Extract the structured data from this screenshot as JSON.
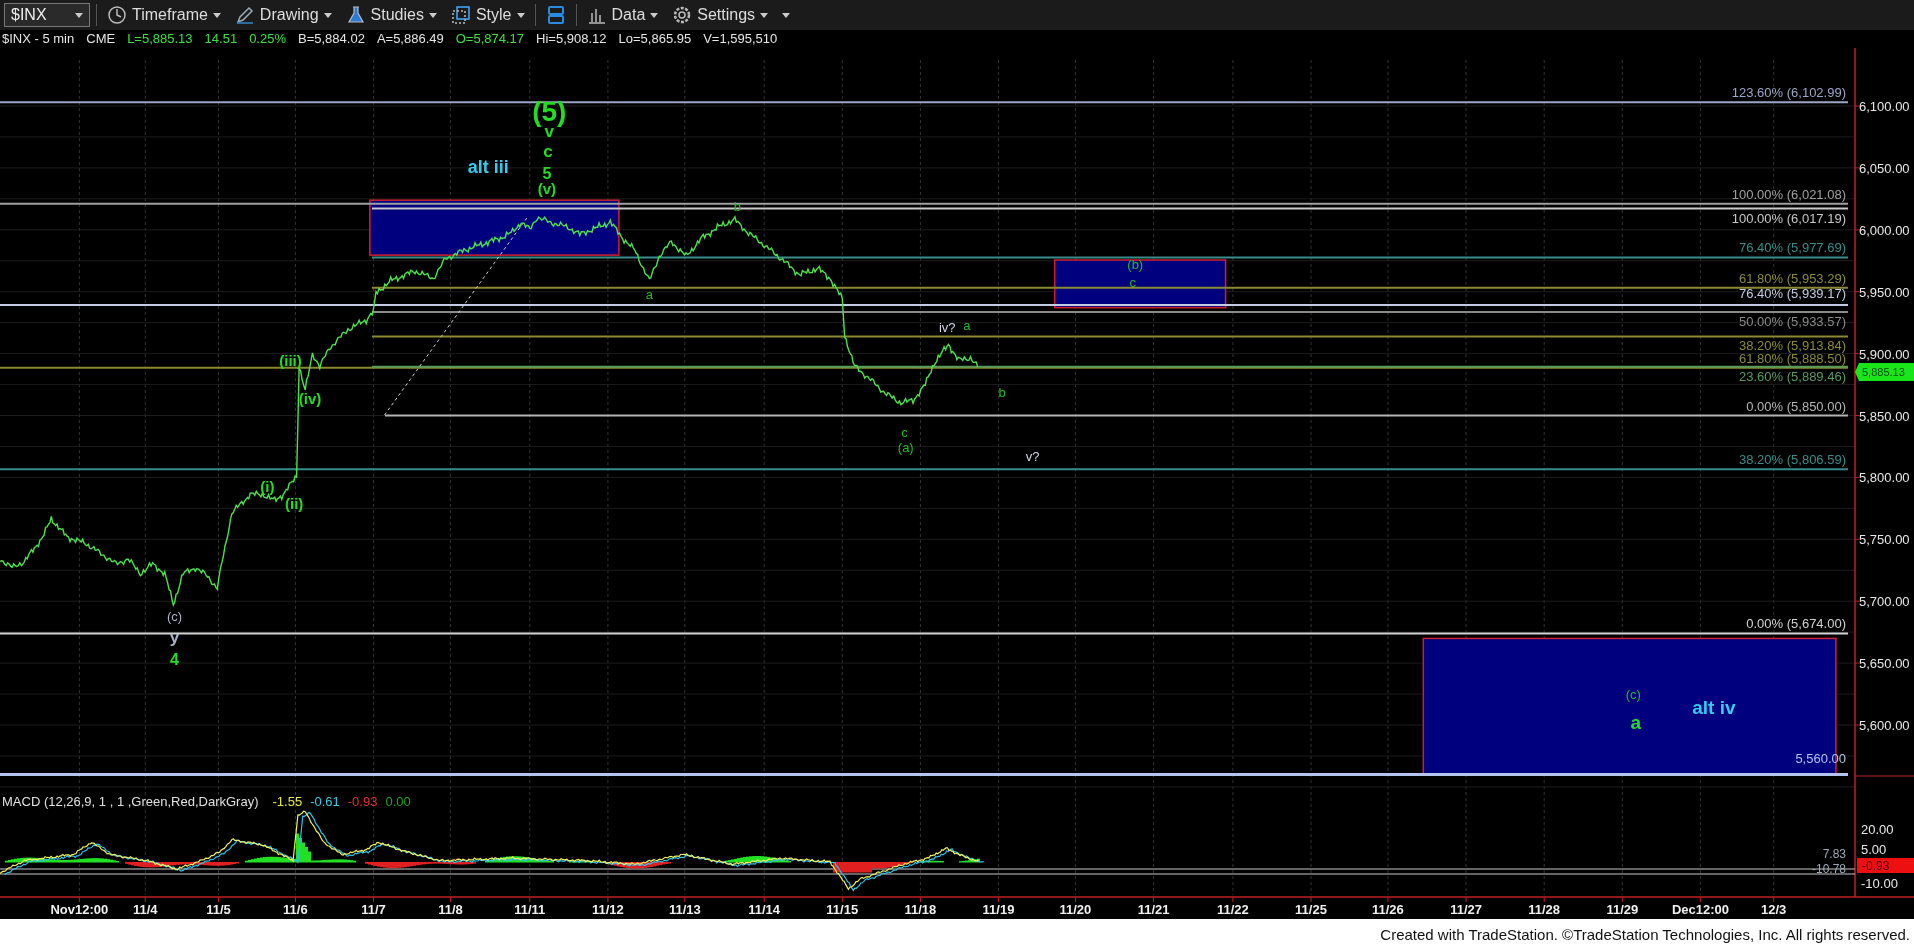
{
  "toolbar": {
    "symbol": "$INX",
    "buttons": [
      {
        "label": "Timeframe"
      },
      {
        "label": "Drawing"
      },
      {
        "label": "Studies"
      },
      {
        "label": "Style"
      },
      {
        "label": "Data"
      },
      {
        "label": "Settings"
      }
    ]
  },
  "quote_line": [
    {
      "text": "$INX - 5 min",
      "color": "#e6e6e6"
    },
    {
      "text": "CME",
      "color": "#e6e6e6"
    },
    {
      "text": "L=5,885.13",
      "color": "#3ee03e"
    },
    {
      "text": "14.51",
      "color": "#3ee03e"
    },
    {
      "text": "0.25%",
      "color": "#3ee03e"
    },
    {
      "text": "B=5,884.02",
      "color": "#e6e6e6"
    },
    {
      "text": "A=5,886.49",
      "color": "#e6e6e6"
    },
    {
      "text": "O=5,874.17",
      "color": "#3ee03e"
    },
    {
      "text": "Hi=5,908.12",
      "color": "#e6e6e6"
    },
    {
      "text": "Lo=5,865.95",
      "color": "#e6e6e6"
    },
    {
      "text": "V=1,595,510",
      "color": "#e6e6e6"
    }
  ],
  "price_axis": {
    "ticks": [
      "6,100.00",
      "6,050.00",
      "6,000.00",
      "5,950.00",
      "5,900.00",
      "5,850.00",
      "5,800.00",
      "5,750.00",
      "5,700.00",
      "5,650.00",
      "5,600.00"
    ],
    "last_price": "5,885.13"
  },
  "fib_levels": [
    {
      "label": "123.60% (6,102.99)",
      "color": "#9aa6c4"
    },
    {
      "label": "100.00% (6,021.08)",
      "color": "#a0a0a0"
    },
    {
      "label": "100.00% (6,017.19)",
      "color": "#c8c8c8"
    },
    {
      "label": "76.40% (5,977.69)",
      "color": "#3a8c8c"
    },
    {
      "label": "61.80% (5,953.29)",
      "color": "#8c8a34"
    },
    {
      "label": "76.40% (5,939.17)",
      "color": "#c4cce4"
    },
    {
      "label": "50.00% (5,933.57)",
      "color": "#8a8a8a"
    },
    {
      "label": "38.20% (5,913.84)",
      "color": "#8c8a34"
    },
    {
      "label": "61.80% (5,888.50)",
      "color": "#8a8a30"
    },
    {
      "label": "23.60% (5,889.46)",
      "color": "#5a9a5a"
    },
    {
      "label": "0.00% (5,850.00)",
      "color": "#b4b4b4"
    },
    {
      "label": "38.20% (5,806.59)",
      "color": "#3a8c8c"
    },
    {
      "label": "0.00% (5,674.00)",
      "color": "#d2d2d2"
    },
    {
      "label": "5,560.00",
      "color": "#b4c4ec"
    }
  ],
  "wave_labels": [
    {
      "text": "(5)",
      "color": "#22dd22"
    },
    {
      "text": "v",
      "color": "#22dd22"
    },
    {
      "text": "c",
      "color": "#22dd22"
    },
    {
      "text": "5",
      "color": "#22dd22"
    },
    {
      "text": "(v)",
      "color": "#22dd22"
    },
    {
      "text": "alt iii",
      "color": "#33ccee"
    },
    {
      "text": "b",
      "color": "#22bb22"
    },
    {
      "text": "a",
      "color": "#22bb22"
    },
    {
      "text": "(iii)",
      "color": "#22dd22"
    },
    {
      "text": "(iv)",
      "color": "#22dd22"
    },
    {
      "text": "(i)",
      "color": "#22dd22"
    },
    {
      "text": "(ii)",
      "color": "#22dd22"
    },
    {
      "text": "(c)",
      "color": "#aab4c8"
    },
    {
      "text": "y",
      "color": "#aab4c8"
    },
    {
      "text": "4",
      "color": "#22dd22"
    },
    {
      "text": "iv?",
      "color": "#d0d4e8"
    },
    {
      "text": "a",
      "color": "#22bb22"
    },
    {
      "text": "b",
      "color": "#22bb22"
    },
    {
      "text": "c",
      "color": "#22bb22"
    },
    {
      "text": "(a)",
      "color": "#22bb22"
    },
    {
      "text": "v?",
      "color": "#d0d4e8"
    },
    {
      "text": "(b)",
      "color": "#22bb22"
    },
    {
      "text": "c",
      "color": "#22bb22"
    },
    {
      "text": "(c)",
      "color": "#22bb22"
    },
    {
      "text": "a",
      "color": "#22dd22"
    },
    {
      "text": "alt iv",
      "color": "#33ccee"
    }
  ],
  "macd": {
    "title": "MACD (12,26,9, 1 , 1 ,Green,Red,DarkGray)",
    "values": [
      {
        "text": "-1.55",
        "color": "#e8e840"
      },
      {
        "text": "-0.61",
        "color": "#40c8e8"
      },
      {
        "text": "-0.93",
        "color": "#e03030"
      },
      {
        "text": "0.00",
        "color": "#20a020"
      }
    ],
    "axis_ticks": [
      "20.00",
      "5.00",
      "-10.00"
    ],
    "readings": [
      "7.83",
      "-10.78"
    ],
    "last_value": "-0.93"
  },
  "date_axis": [
    "Nov12:00",
    "11/4",
    "11/5",
    "11/6",
    "11/7",
    "11/8",
    "11/11",
    "11/12",
    "11/13",
    "11/14",
    "11/15",
    "11/18",
    "11/19",
    "11/20",
    "11/21",
    "11/22",
    "11/25",
    "11/26",
    "11/27",
    "11/28",
    "11/29",
    "Dec12:00",
    "12/3"
  ],
  "footer": "Created with TradeStation. ©TradeStation Technologies, Inc. All rights reserved."
}
